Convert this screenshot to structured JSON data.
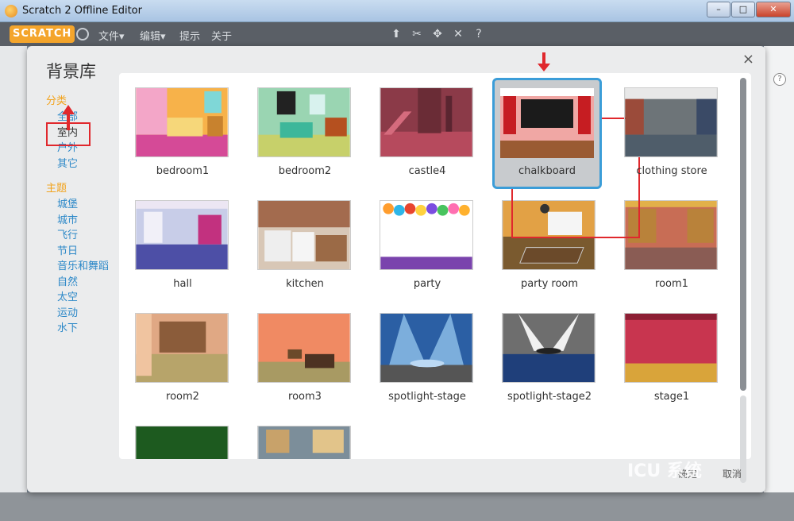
{
  "window": {
    "title": "Scratch 2 Offline Editor",
    "minimize": "–",
    "maximize": "□",
    "close": "✕"
  },
  "menubar": {
    "logo": "SCRATCH",
    "menus": [
      "文件▾",
      "编辑▾",
      "提示",
      "关于"
    ],
    "tools": [
      "duplicate-icon",
      "delete-icon",
      "grow-icon",
      "shrink-icon",
      "help-icon"
    ]
  },
  "dialog": {
    "title": "背景库",
    "close": "×",
    "categories": {
      "heading": "分类",
      "items": [
        "全部",
        "室内",
        "户外",
        "其它"
      ],
      "selected": "室内"
    },
    "themes": {
      "heading": "主题",
      "items": [
        "城堡",
        "城市",
        "飞行",
        "节日",
        "音乐和舞蹈",
        "自然",
        "太空",
        "运动",
        "水下"
      ]
    },
    "backdrops": [
      {
        "name": "bedroom1"
      },
      {
        "name": "bedroom2"
      },
      {
        "name": "castle4"
      },
      {
        "name": "chalkboard"
      },
      {
        "name": "clothing store"
      },
      {
        "name": "hall"
      },
      {
        "name": "kitchen"
      },
      {
        "name": "party"
      },
      {
        "name": "party room"
      },
      {
        "name": "room1"
      },
      {
        "name": "room2"
      },
      {
        "name": "room3"
      },
      {
        "name": "spotlight-stage"
      },
      {
        "name": "spotlight-stage2"
      },
      {
        "name": "stage1"
      },
      {
        "name": ""
      },
      {
        "name": ""
      }
    ],
    "selected_backdrop": "chalkboard",
    "ok": "确定",
    "cancel": "取消"
  },
  "watermark": "ICU 系统"
}
